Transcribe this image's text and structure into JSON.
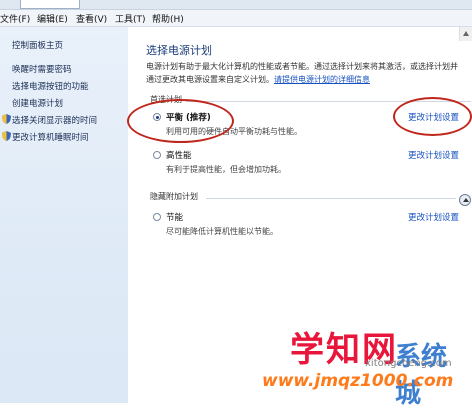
{
  "menubar": {
    "items": [
      "文件(F)",
      "编辑(E)",
      "查看(V)",
      "工具(T)",
      "帮助(H)"
    ]
  },
  "sidebar": {
    "home": "控制面板主页",
    "links": [
      "唤醒时需要密码",
      "选择电源按钮的功能",
      "创建电源计划",
      "选择关闭显示器的时间",
      "更改计算机睡眠时间"
    ]
  },
  "main": {
    "title": "选择电源计划",
    "description_line1": "电源计划有助于最大化计算机的性能或者节能。通过选择计划来将其激活，或选择计划并",
    "description_line2": "通过更改其电源设置来自定义计划。",
    "description_link": "请提供电源计划的详细信息",
    "preferred_label": "首选计划",
    "plans": [
      {
        "name": "平衡 (推荐)",
        "desc": "利用可用的硬件自动平衡功耗与性能。",
        "change": "更改计划设置",
        "selected": true
      },
      {
        "name": "高性能",
        "desc": "有利于提高性能，但会增加功耗。",
        "change": "更改计划设置",
        "selected": false
      }
    ],
    "hidden_label": "隐藏附加计划",
    "hidden_plans": [
      {
        "name": "节能",
        "desc": "尽可能降低计算机性能以节能。",
        "change": "更改计划设置",
        "selected": false
      }
    ]
  },
  "watermark": {
    "big": "学知网",
    "side": "系统城",
    "url": "www.jmqz1000.com",
    "url2": "xitongcheng.com"
  },
  "colors": {
    "link": "#1550c1",
    "annotation": "#c0271c",
    "sidebar_bg": "#e9f1fa"
  }
}
